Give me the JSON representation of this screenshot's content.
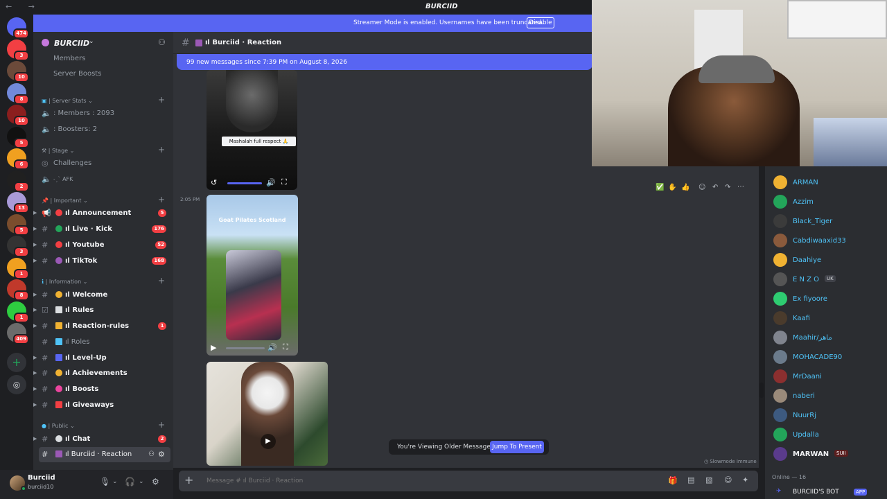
{
  "window": {
    "title": "BURCIID"
  },
  "banner": {
    "text": "Streamer Mode is enabled. Usernames have been truncated.",
    "button": "Disable"
  },
  "server": {
    "name": "BURCIID"
  },
  "rail": {
    "servers": [
      {
        "badge": "474",
        "color": "#5865f2"
      },
      {
        "badge": "3",
        "color": "#f23f43"
      },
      {
        "badge": "10",
        "color": "#6b4a3a"
      },
      {
        "badge": "8",
        "color": "#7289da"
      },
      {
        "badge": "10",
        "color": "#8b1e1e"
      },
      {
        "badge": "5",
        "color": "#111111"
      },
      {
        "badge": "6",
        "color": "#f0a020"
      },
      {
        "badge": "2",
        "color": "#202020"
      },
      {
        "badge": "13",
        "color": "#a99ad8"
      },
      {
        "badge": "5",
        "color": "#7a4d2d"
      },
      {
        "badge": "3",
        "color": "#333333"
      },
      {
        "badge": "1",
        "color": "#f0a020"
      },
      {
        "badge": "8",
        "color": "#c0392b"
      },
      {
        "badge": "1",
        "color": "#2ecc40"
      },
      {
        "badge": "409",
        "color": "#6b6b6b"
      }
    ]
  },
  "sidebar": {
    "members": "Members",
    "boosts": "Server Boosts",
    "cat_stats": "| Server Stats",
    "members_count": "꞉ Members : 2093",
    "boosters": "꞉ Boosters: 2",
    "cat_stage": "| Stage",
    "challenges": "Challenges",
    "afk": "˗ˏˋ AFK",
    "cat_important": "| Important",
    "announcement": "ıl Announcement",
    "announcement_badge": "5",
    "live": "ıl Live · Kick",
    "live_badge": "176",
    "youtube": "ıl Youtube",
    "youtube_badge": "52",
    "tiktok": "ıl TikTok",
    "tiktok_badge": "168",
    "cat_info": "| Information",
    "welcome": "ıl Welcome",
    "rules": "ıl Rules",
    "reaction_rules": "ıl Reaction-rules",
    "reaction_rules_badge": "1",
    "roles": "ıl Roles",
    "levelup": "ıl Level-Up",
    "achievements": "ıl Achievements",
    "boosts_ch": "ıl Boosts",
    "giveaways": "ıl Giveaways",
    "cat_public": "| Public",
    "chat": "ıl Chat",
    "chat_badge": "2",
    "reaction": "ıl Burciid · Reaction"
  },
  "user": {
    "name": "Burciid",
    "status": "burciid10"
  },
  "channel": {
    "name": "ıl Burciid · Reaction"
  },
  "messages": {
    "new_banner": "99 new messages since 7:39 PM on August 8, 2026",
    "caption": "Mashalah full respect 🙏",
    "timestamp": "2:05 PM",
    "video_title": "Goat Pilates Scotland",
    "older": "You're Viewing Older Messages",
    "jump": "Jump To Present",
    "slowmode": "Slowmode Immune"
  },
  "composer": {
    "placeholder": "Message # ıl Burciid · Reaction"
  },
  "members_list": {
    "items": [
      {
        "name": "ARMAN",
        "color": "#f0b232"
      },
      {
        "name": "Azzim",
        "color": "#23a55a"
      },
      {
        "name": "Black_Tiger",
        "color": "#3b3b3b"
      },
      {
        "name": "Cabdiwaaxid33",
        "color": "#8a5a3c"
      },
      {
        "name": "Daahiye",
        "color": "#f0b232"
      },
      {
        "name": "E N Z O",
        "color": "#555555"
      },
      {
        "name": "Ex fiyoore",
        "color": "#2ecc71"
      },
      {
        "name": "Kaafi",
        "color": "#4a3b2c"
      },
      {
        "name": "Maahir/ماهر",
        "color": "#80848e"
      },
      {
        "name": "MOHACADE90",
        "color": "#6b7b8c"
      },
      {
        "name": "MrDaani",
        "color": "#8c2f2f"
      },
      {
        "name": "naberi",
        "color": "#9a8a7a"
      },
      {
        "name": "NuurRj",
        "color": "#3d5a80"
      },
      {
        "name": "Updalla",
        "color": "#23a55a"
      },
      {
        "name": "MARWAN",
        "color": "#5a3b8c"
      }
    ],
    "enzo_tag": "UK",
    "marwan_tag": "SUII",
    "online": "Online — 16",
    "bot": "BURCIID'S BOT",
    "bot_tag": "APP"
  }
}
